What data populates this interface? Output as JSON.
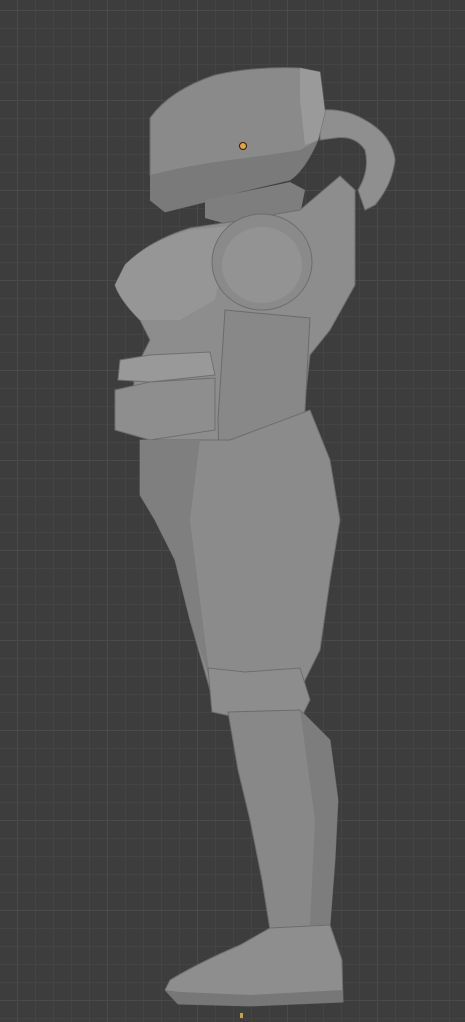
{
  "viewport": {
    "background_color": "#3d3d3d",
    "grid_line_color": "#4a4a4a",
    "mesh_color": "#8c8c8c",
    "origin_color": "#f0a030"
  },
  "model": {
    "view": "side",
    "shading": "solid"
  }
}
